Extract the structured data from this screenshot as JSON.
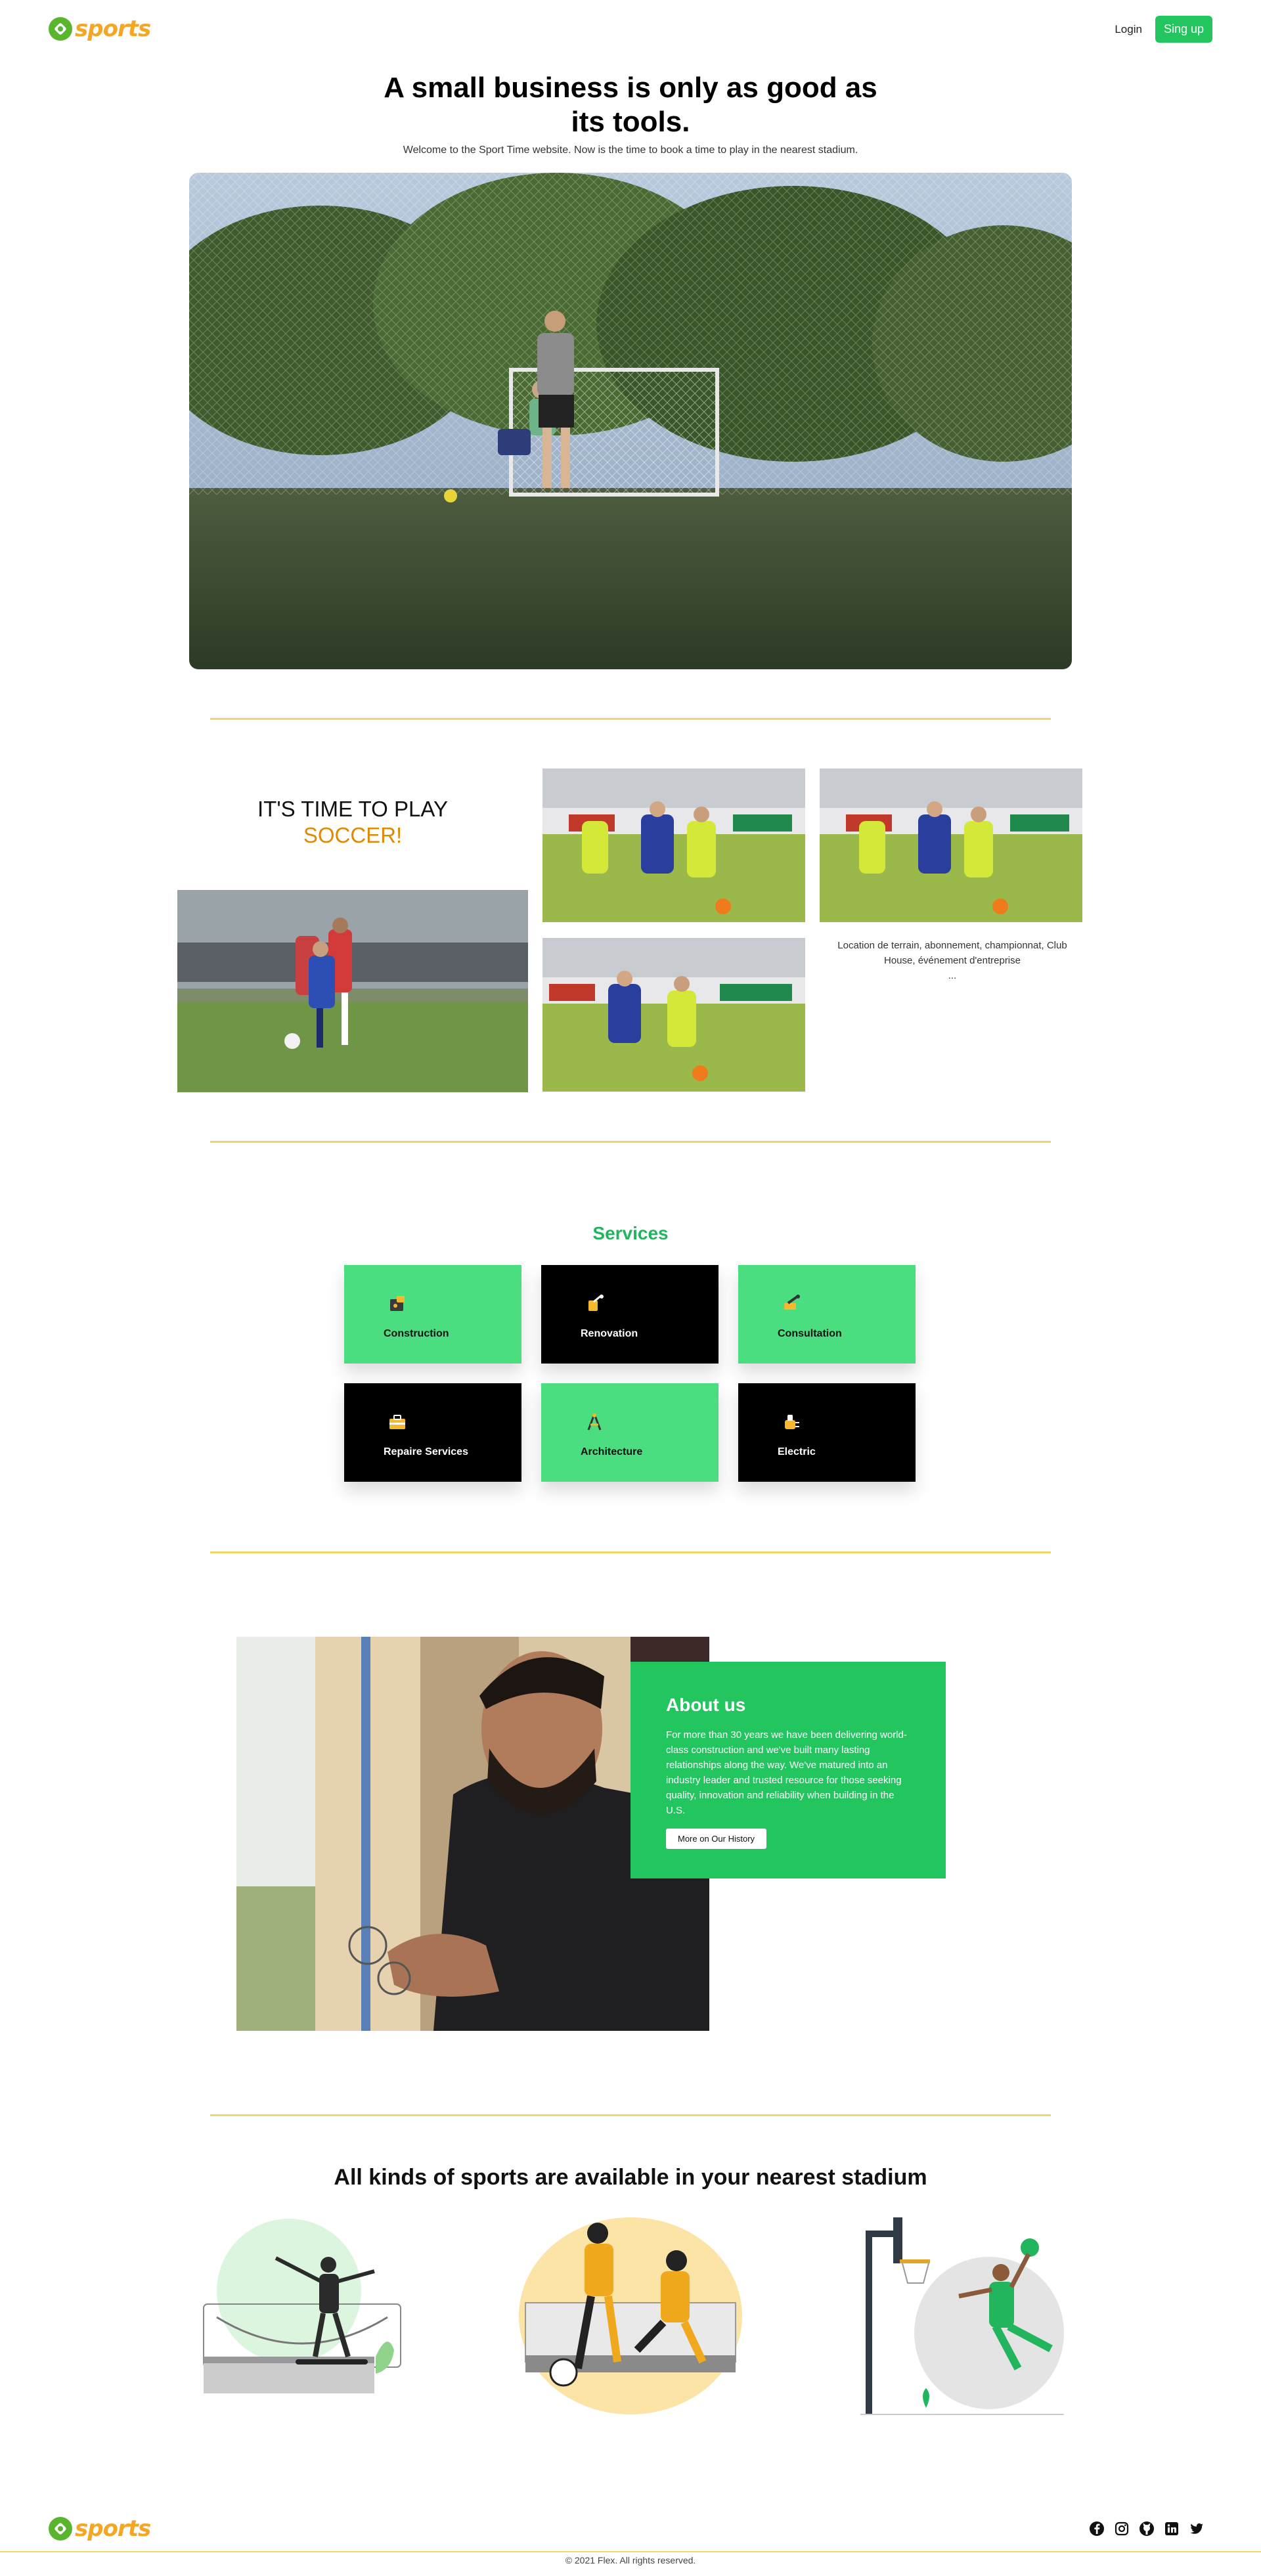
{
  "header": {
    "logo_text": "sports",
    "login_label": "Login",
    "signup_label": "Sing up"
  },
  "hero": {
    "title": "A small business is only as good as its tools.",
    "subtitle": "Welcome to the Sport Time website. Now is the time to book a time to play in the nearest stadium."
  },
  "soccer": {
    "title_line1": "IT'S TIME TO PLAY",
    "title_line2": "SOCCER!",
    "caption": "Location de terrain, abonnement, championnat, Club House, événement d'entreprise",
    "caption_more": "..."
  },
  "services": {
    "title": "Services",
    "items": [
      {
        "label": "Construction",
        "icon": "construction-icon",
        "theme": "green"
      },
      {
        "label": "Renovation",
        "icon": "renovation-icon",
        "theme": "black"
      },
      {
        "label": "Consultation",
        "icon": "consultation-icon",
        "theme": "green"
      },
      {
        "label": "Repaire Services",
        "icon": "repair-icon",
        "theme": "black"
      },
      {
        "label": "Architecture",
        "icon": "architecture-icon",
        "theme": "green"
      },
      {
        "label": "Electric",
        "icon": "electric-icon",
        "theme": "black"
      }
    ]
  },
  "about": {
    "title": "About us",
    "text": "For more than 30 years we have been delivering world-class construction and we've built many lasting relationships along the way. We've matured into an industry leader and trusted resource for those seeking quality, innovation and reliability when building in the U.S.",
    "button_label": "More on Our History"
  },
  "sports": {
    "title": "All kinds of sports are available in your nearest stadium"
  },
  "footer": {
    "logo_text": "sports",
    "copyright": "© 2021 Flex. All rights reserved.",
    "social": [
      "facebook-icon",
      "instagram-icon",
      "github-icon",
      "linkedin-icon",
      "twitter-icon"
    ]
  },
  "colors": {
    "brand_green": "#22c55e",
    "card_green": "#4ade80",
    "logo_orange": "#f5a623",
    "accent_orange": "#e08a00",
    "divider_yellow": "#f3d56a"
  }
}
